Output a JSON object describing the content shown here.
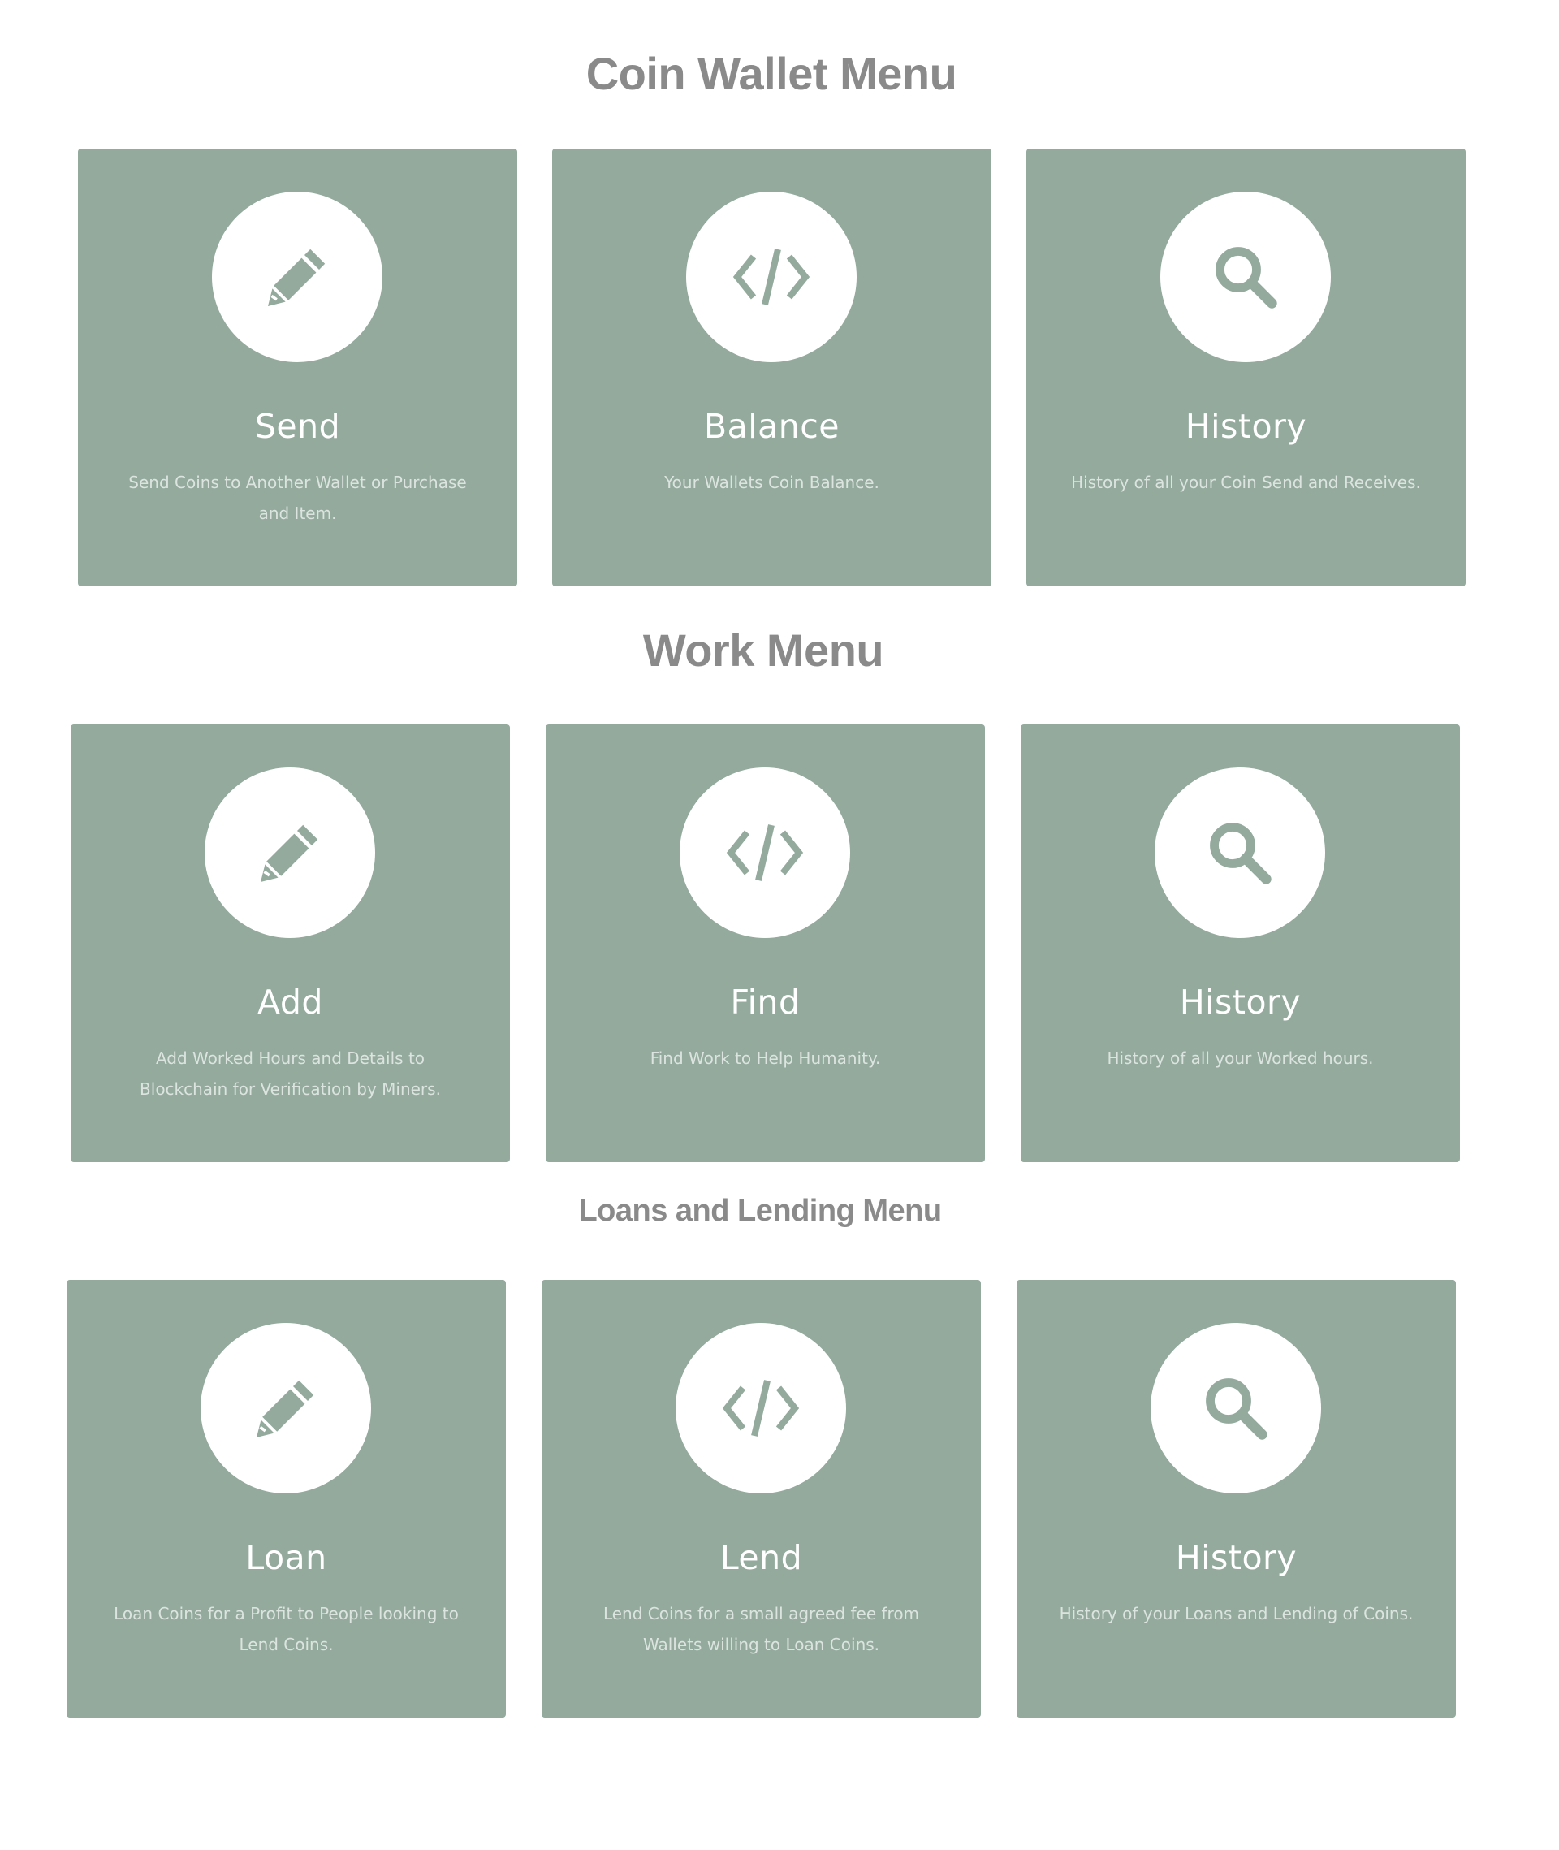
{
  "colors": {
    "card_background": "#93aa9d",
    "icon_circle": "#ffffff",
    "icon_color": "#93aa9d",
    "heading_color": "#8a8a8a"
  },
  "sections": [
    {
      "title": "Coin Wallet Menu",
      "cards": [
        {
          "title": "Send",
          "description": "Send Coins to Another Wallet or Purchase and Item.",
          "icon": "pencil-icon"
        },
        {
          "title": "Balance",
          "description": "Your Wallets Coin Balance.",
          "icon": "code-icon"
        },
        {
          "title": "History",
          "description": "History of all your Coin Send and Receives.",
          "icon": "search-icon"
        }
      ]
    },
    {
      "title": "Work Menu",
      "cards": [
        {
          "title": "Add",
          "description": "Add Worked Hours and Details to Blockchain for Verification by Miners.",
          "icon": "pencil-icon"
        },
        {
          "title": "Find",
          "description": "Find Work to Help Humanity.",
          "icon": "code-icon"
        },
        {
          "title": "History",
          "description": "History of all your Worked hours.",
          "icon": "search-icon"
        }
      ]
    },
    {
      "title": "Loans and Lending Menu",
      "cards": [
        {
          "title": "Loan",
          "description": "Loan Coins for a Profit to People looking to Lend Coins.",
          "icon": "pencil-icon"
        },
        {
          "title": "Lend",
          "description": "Lend Coins for a small agreed fee from Wallets willing to Loan Coins.",
          "icon": "code-icon"
        },
        {
          "title": "History",
          "description": "History of your Loans and Lending of Coins.",
          "icon": "search-icon"
        }
      ]
    }
  ]
}
